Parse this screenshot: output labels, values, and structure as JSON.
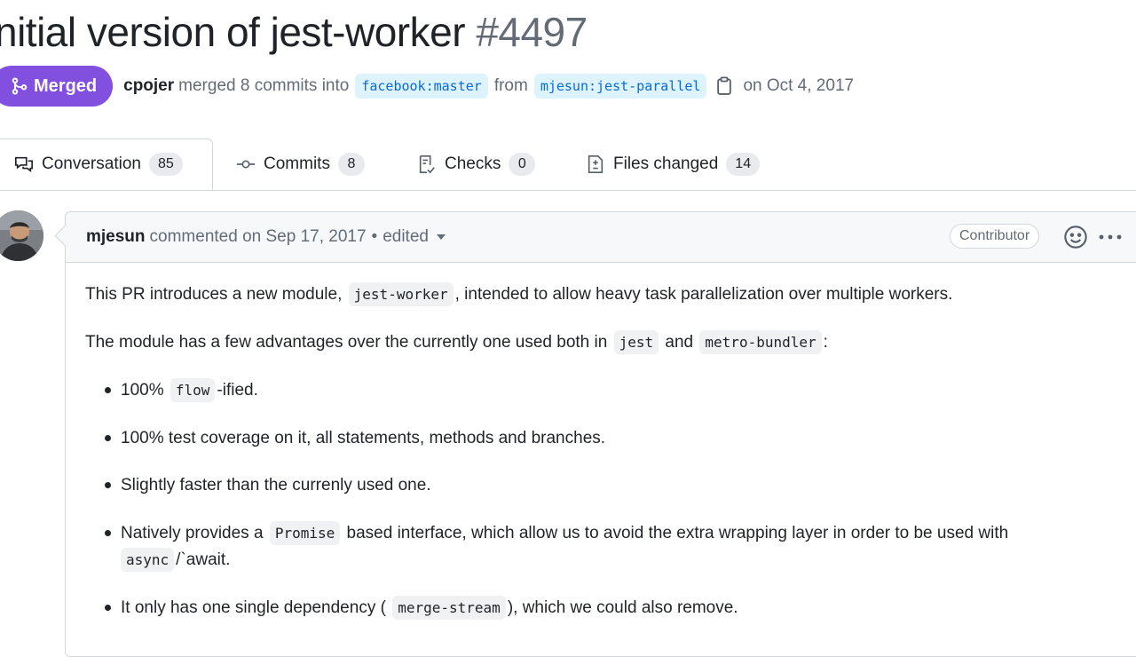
{
  "pr": {
    "title": "nitial version of jest-worker",
    "number": "#4497",
    "status": "Merged",
    "author": "cpojer",
    "merge_text": "merged 8 commits into",
    "base_branch": "facebook:master",
    "from_text": "from",
    "head_branch": "mjesun:jest-parallel",
    "date_text": "on Oct 4, 2017"
  },
  "tabs": [
    {
      "label": "Conversation",
      "count": "85",
      "icon": "comment-discussion-icon"
    },
    {
      "label": "Commits",
      "count": "8",
      "icon": "git-commit-icon"
    },
    {
      "label": "Checks",
      "count": "0",
      "icon": "checklist-icon"
    },
    {
      "label": "Files changed",
      "count": "14",
      "icon": "file-diff-icon"
    }
  ],
  "comment": {
    "author": "mjesun",
    "action": "commented on Sep 17, 2017",
    "separator": "•",
    "edited": "edited",
    "role": "Contributor",
    "p1_a": "This PR introduces a new module,",
    "p1_code": "jest-worker",
    "p1_b": ", intended to allow heavy task parallelization over multiple workers.",
    "p2_a": "The module has a few advantages over the currently one used both in",
    "p2_code1": "jest",
    "p2_and": "and",
    "p2_code2": "metro-bundler",
    "p2_b": ":",
    "b1_a": "100%",
    "b1_code": "flow",
    "b1_b": "-ified.",
    "b2": "100% test coverage on it, all statements, methods and branches.",
    "b3": "Slightly faster than the currenly used one.",
    "b4_a": "Natively provides a",
    "b4_code": "Promise",
    "b4_b": "based interface, which allow us to avoid the extra wrapping layer in order to be used with",
    "b4_code2": "async",
    "b4_c": "/`await.",
    "b5_a": "It only has one single dependency (",
    "b5_code": "merge-stream",
    "b5_b": "), which we could also remove."
  },
  "colors": {
    "merged": "#8250df",
    "branch_bg": "#ddf4ff",
    "branch_fg": "#0969da",
    "muted": "#636c76"
  }
}
